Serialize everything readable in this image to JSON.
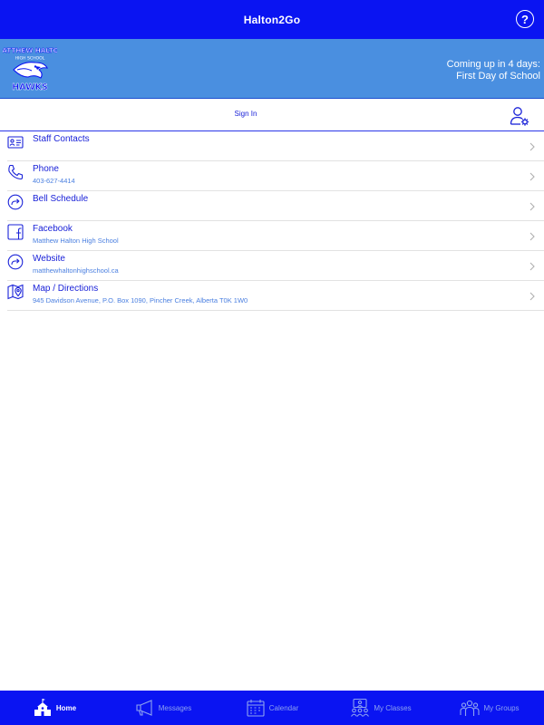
{
  "header": {
    "title": "Halton2Go",
    "help_glyph": "?"
  },
  "banner": {
    "logo": {
      "school_name": "MATTHEW HALTON",
      "school_type": "HIGH SCHOOL",
      "team": "HAWKS"
    },
    "upcoming_line1": "Coming up in 4 days:",
    "upcoming_line2": "First Day of School"
  },
  "signin": {
    "label": "Sign In"
  },
  "list": [
    {
      "label": "Staff Contacts",
      "sub": "",
      "icon": "contact-card-icon"
    },
    {
      "label": "Phone",
      "sub": "403-627-4414",
      "icon": "phone-icon"
    },
    {
      "label": "Bell Schedule",
      "sub": "",
      "icon": "link-arrow-icon"
    },
    {
      "label": "Facebook",
      "sub": "Matthew Halton High School",
      "icon": "facebook-icon"
    },
    {
      "label": "Website",
      "sub": "matthewhaltonhighschool.ca",
      "icon": "link-arrow-icon"
    },
    {
      "label": "Map / Directions",
      "sub": "945 Davidson Avenue, P.O. Box 1090, Pincher Creek, Alberta T0K 1W0",
      "icon": "map-pin-icon"
    }
  ],
  "tabs": [
    {
      "label": "Home",
      "icon": "school-house-icon",
      "active": true
    },
    {
      "label": "Messages",
      "icon": "megaphone-icon",
      "active": false
    },
    {
      "label": "Calendar",
      "icon": "calendar-icon",
      "active": false
    },
    {
      "label": "My Classes",
      "icon": "classroom-icon",
      "active": false
    },
    {
      "label": "My Groups",
      "icon": "group-icon",
      "active": false
    }
  ],
  "colors": {
    "primary": "#0a14f2",
    "banner": "#4a8fe0",
    "link": "#1a22d8",
    "subtext": "#4a7fe0"
  }
}
